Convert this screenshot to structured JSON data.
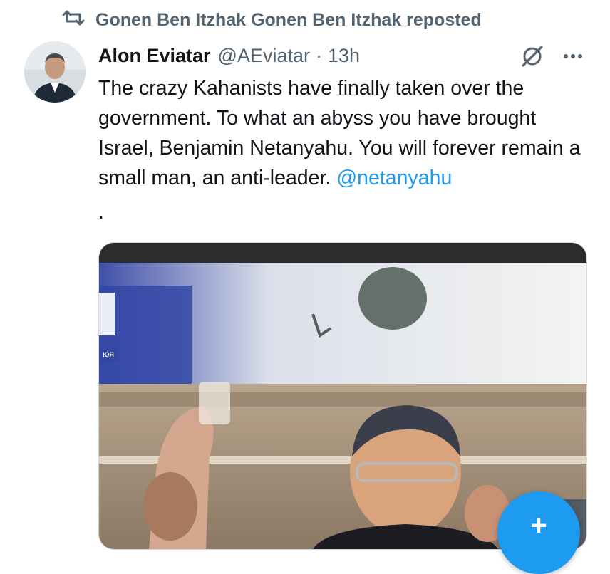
{
  "repost": {
    "icon": "repost-icon",
    "text": "Gonen Ben Itzhak Gonen Ben Itzhak reposted"
  },
  "tweet": {
    "author_name": "Alon Eviatar",
    "handle": "@AEviatar",
    "separator": "·",
    "time": "13h",
    "text_main": "The crazy Kahanists have finally taken over the government. To what an abyss you have brought Israel, Benjamin Netanyahu. You will forever remain a small man, an anti-leader. ",
    "mention": "@netanyahu",
    "trailing": "."
  },
  "media": {
    "type": "video-still",
    "left_sign_text": "ЮЯ"
  },
  "fab": {
    "icon": "compose-icon",
    "label": "+"
  },
  "colors": {
    "accent": "#1d9bf0",
    "secondary_text": "#536471",
    "primary_text": "#0f1419"
  }
}
